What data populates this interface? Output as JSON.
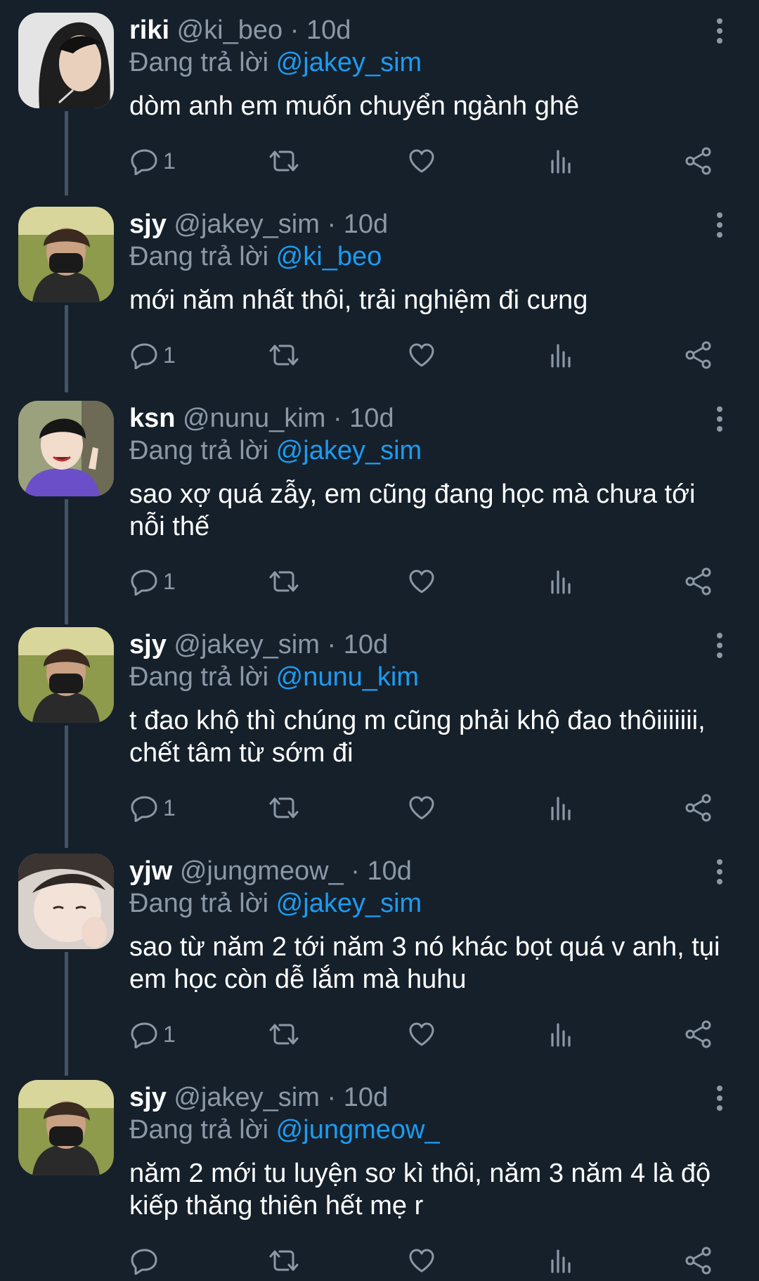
{
  "colors": {
    "background": "#15202b",
    "primary_text": "#ffffff",
    "secondary_text": "#8b98a5",
    "mention": "#1d9bf0",
    "thread_line": "#425466",
    "icon": "#8b98a5"
  },
  "replying_prefix": "Đang trả lời",
  "separator": "·",
  "tweets": [
    {
      "name": "riki",
      "handle": "@ki_beo",
      "time": "10d",
      "reply_to": "@jakey_sim",
      "text": "dòm anh em muốn chuyển ngành ghê",
      "reply_count": "1",
      "icons": [
        "reply-icon",
        "retweet-icon",
        "like-icon",
        "analytics-icon",
        "share-icon",
        "more-icon"
      ]
    },
    {
      "name": "sjy",
      "handle": "@jakey_sim",
      "time": "10d",
      "reply_to": "@ki_beo",
      "text": "mới năm nhất thôi, trải nghiệm đi cưng",
      "reply_count": "1"
    },
    {
      "name": "ksn",
      "handle": "@nunu_kim",
      "time": "10d",
      "reply_to": "@jakey_sim",
      "text": "sao xợ quá zẫy, em cũng đang học mà chưa tới nỗi thế",
      "reply_count": "1"
    },
    {
      "name": "sjy",
      "handle": "@jakey_sim",
      "time": "10d",
      "reply_to": "@nunu_kim",
      "text": "t đao khộ thì chúng m cũng phải khộ đao thôiiiiiii, chết tâm từ sớm đi",
      "reply_count": "1"
    },
    {
      "name": "yjw",
      "handle": "@jungmeow_",
      "time": "10d",
      "reply_to": "@jakey_sim",
      "text": "sao từ năm 2 tới năm 3 nó khác bọt quá v anh, tụi em học còn dễ lắm mà huhu",
      "reply_count": "1"
    },
    {
      "name": "sjy",
      "handle": "@jakey_sim",
      "time": "10d",
      "reply_to": "@jungmeow_",
      "text": "năm 2 mới tu luyện sơ kì thôi, năm 3 năm 4 là độ kiếp thăng thiên hết mẹ r",
      "reply_count": ""
    }
  ]
}
